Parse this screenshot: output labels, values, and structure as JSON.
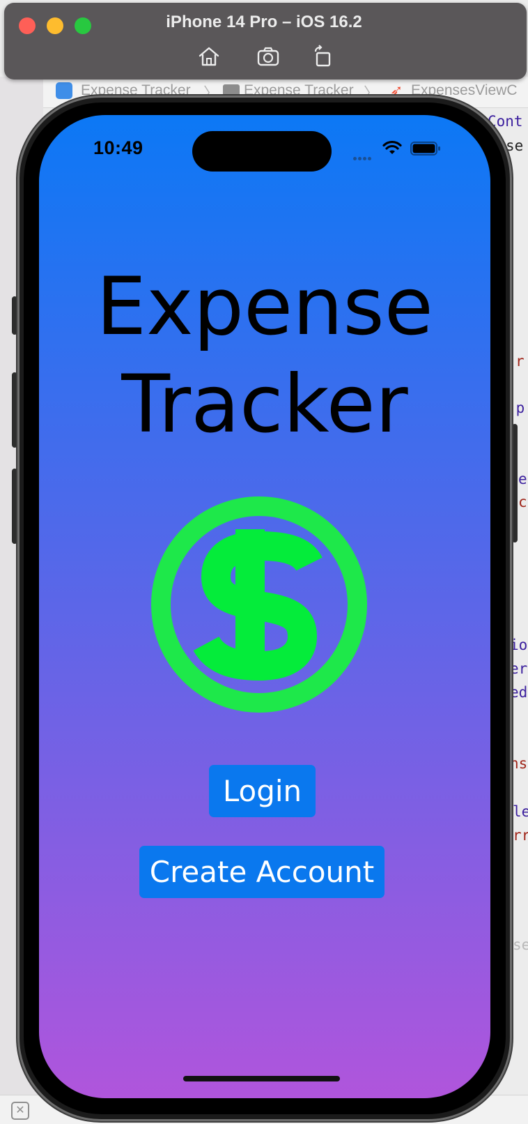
{
  "simulator": {
    "title": "iPhone 14 Pro – iOS 16.2",
    "toolbar": {
      "home_icon": "home-icon",
      "screenshot_icon": "camera-icon",
      "rotate_icon": "rotate-icon"
    }
  },
  "xcode": {
    "breadcrumb": [
      "Expense Tracker",
      "Expense Tracker",
      "ExpensesViewC"
    ],
    "code_fragments": [
      "Cont",
      "se",
      "r",
      ".p",
      "e",
      "c",
      "io",
      "er",
      "ed",
      "ns",
      "le",
      "rr",
      "se"
    ]
  },
  "status_bar": {
    "time": "10:49"
  },
  "app": {
    "title": "Expense Tracker",
    "title_line1": "Expense",
    "title_line2": "Tracker",
    "logo_icon": "dollar-sign-icon",
    "login_label": "Login",
    "create_account_label": "Create Account",
    "colors": {
      "gradient_top": "#0c78f5",
      "gradient_bottom": "#b055dc",
      "button": "#0a78ee",
      "logo_green": "#1ee84a"
    }
  }
}
